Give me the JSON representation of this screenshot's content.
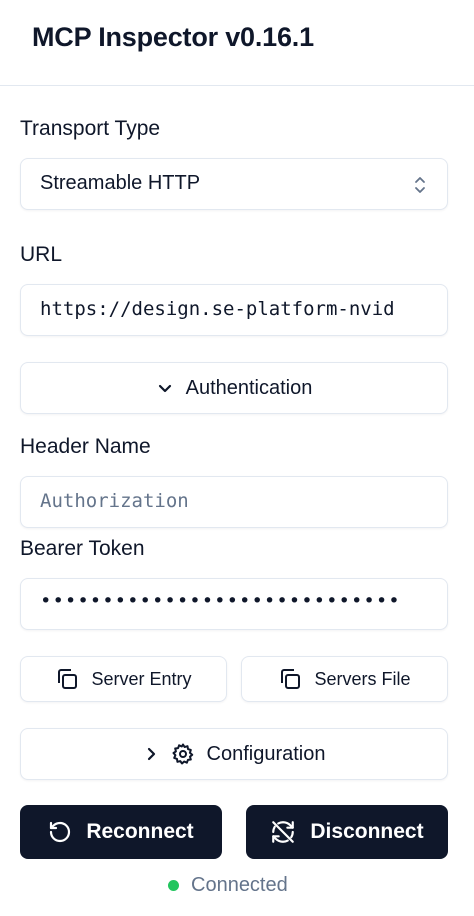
{
  "app": {
    "title": "MCP Inspector v0.16.1"
  },
  "transport": {
    "label": "Transport Type",
    "value": "Streamable HTTP",
    "icon": "chevron-up-down-icon"
  },
  "url": {
    "label": "URL",
    "value": "https://design.se-platform-nvid"
  },
  "auth": {
    "toggle_label": "Authentication",
    "icon": "chevron-down-icon",
    "header_name_label": "Header Name",
    "header_name_placeholder": "Authorization",
    "bearer_token_label": "Bearer Token",
    "bearer_token_value": "•••••••••••••••••••••••••••••"
  },
  "copy_buttons": {
    "server_entry": "Server Entry",
    "servers_file": "Servers File",
    "icon": "copy-icon"
  },
  "configuration": {
    "label": "Configuration",
    "icons": [
      "chevron-right-icon",
      "gear-icon"
    ]
  },
  "actions": {
    "reconnect": "Reconnect",
    "disconnect": "Disconnect",
    "reconnect_icon": "rotate-ccw-icon",
    "disconnect_icon": "refresh-off-icon"
  },
  "status": {
    "text": "Connected",
    "color": "#22c55e"
  },
  "colors": {
    "primary_dark": "#0f172a",
    "border": "#e2e8f0",
    "muted_text": "#64748b"
  }
}
